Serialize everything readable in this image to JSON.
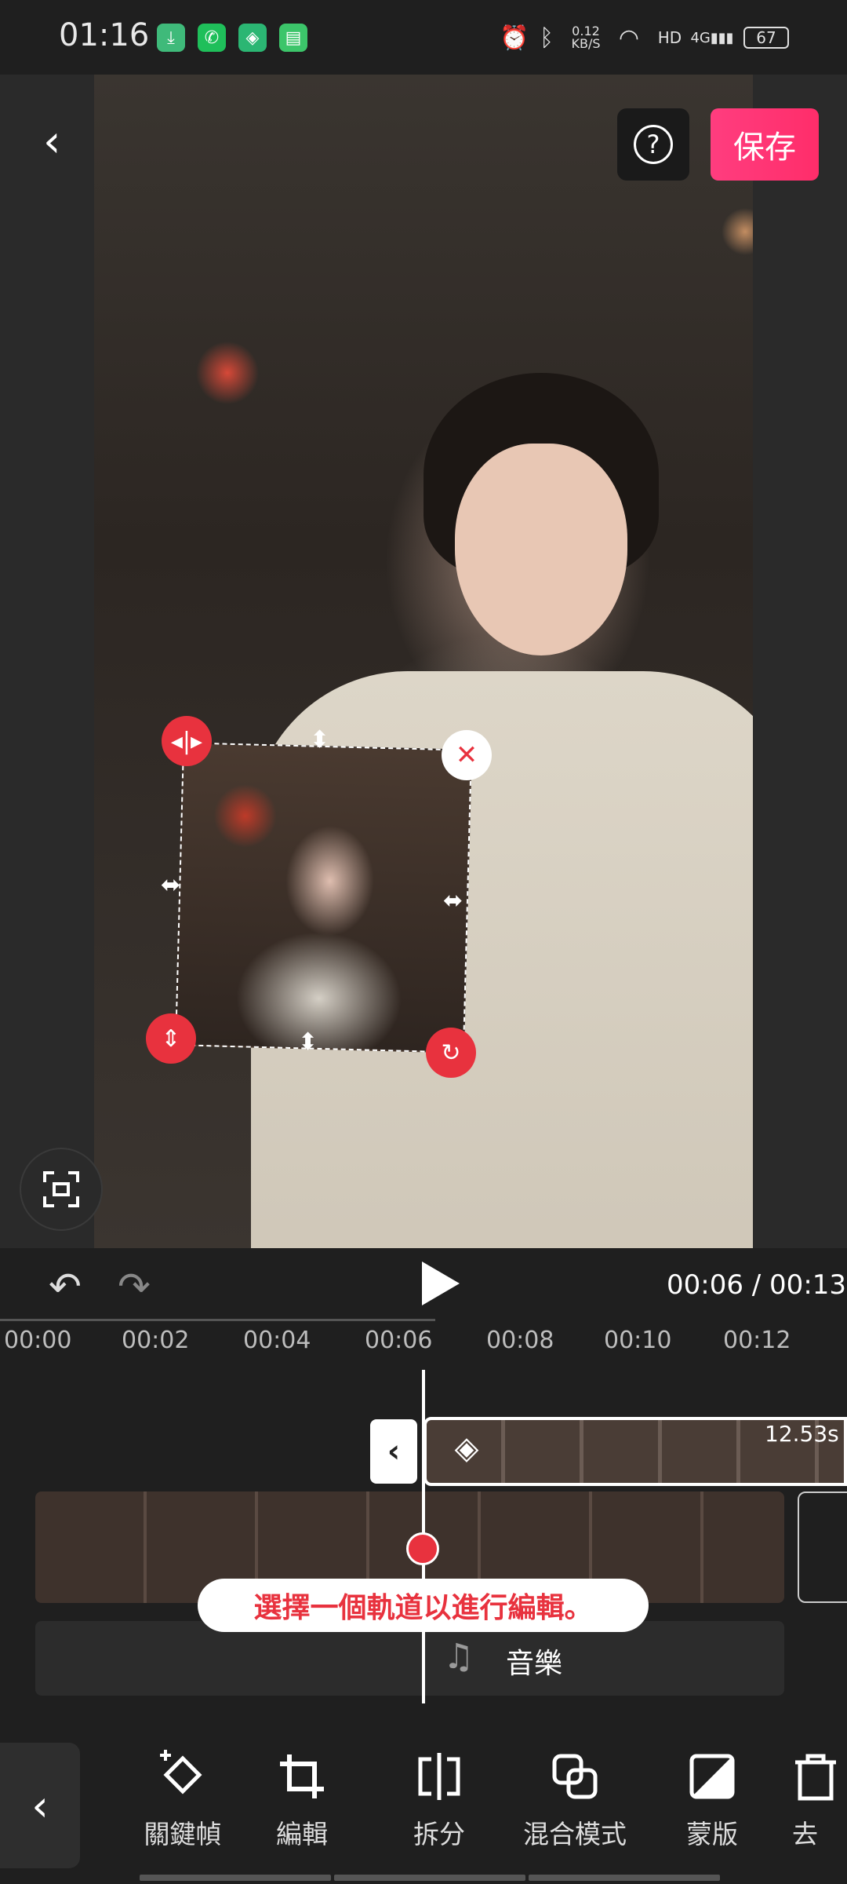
{
  "status_bar": {
    "time": "01:16",
    "network_speed": "0.12\nKB/S",
    "network_type": "4G",
    "battery": "67",
    "icons": [
      "download-icon",
      "phone-icon",
      "shield-icon",
      "chat-icon",
      "alarm-icon",
      "bluetooth-icon",
      "wifi-icon",
      "hd-icon",
      "signal-icon"
    ]
  },
  "header": {
    "back_label": "‹",
    "help_label": "?",
    "save_label": "保存"
  },
  "playback": {
    "undo_icon": "↶",
    "redo_icon": "↷",
    "timecode": "00:06 / 00:13"
  },
  "ruler": {
    "ticks": [
      "00:00",
      "00:02",
      "00:04",
      "00:06",
      "00:08",
      "00:10",
      "00:12"
    ]
  },
  "timeline": {
    "overlay_duration": "12.53s",
    "hint": "選擇一個軌道以進行編輯。",
    "music_label": "音樂"
  },
  "toolbar": {
    "items": [
      {
        "label": "關鍵幀",
        "icon": "keyframe-icon"
      },
      {
        "label": "編輯",
        "icon": "crop-icon"
      },
      {
        "label": "拆分",
        "icon": "split-icon"
      },
      {
        "label": "混合模式",
        "icon": "blend-icon"
      },
      {
        "label": "蒙版",
        "icon": "mask-icon"
      },
      {
        "label": "去",
        "icon": "delete-icon"
      }
    ]
  },
  "colors": {
    "accent_red": "#e8323e",
    "save_pink": "#ff2d6a",
    "background": "#1f1f1f"
  }
}
